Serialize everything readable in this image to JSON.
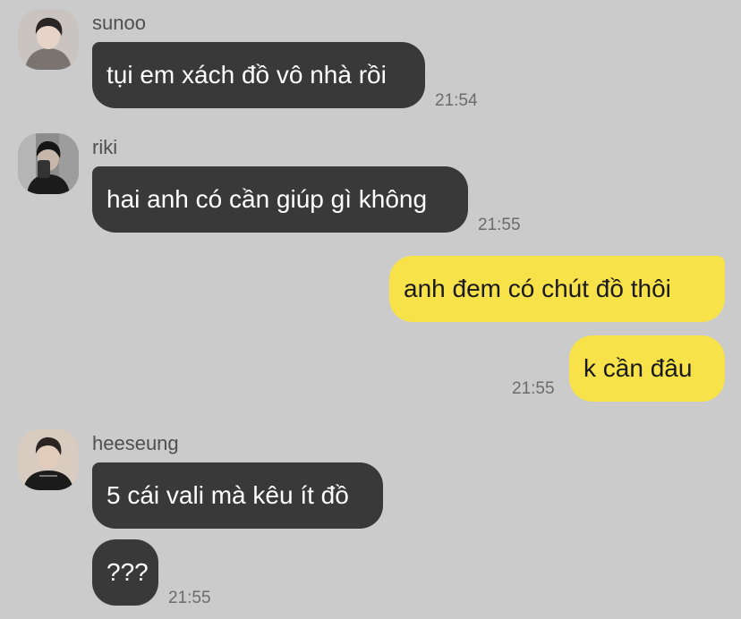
{
  "messages": [
    {
      "sender": "sunoo",
      "text": "tụi em xách đồ vô nhà rồi",
      "time": "21:54"
    },
    {
      "sender": "riki",
      "text": "hai anh có cần giúp gì không",
      "time": "21:55"
    },
    {
      "text": "anh đem có chút đồ thôi"
    },
    {
      "text": "k cần đâu",
      "time": "21:55"
    },
    {
      "sender": "heeseung",
      "text": "5 cái vali mà kêu ít đồ"
    },
    {
      "text": "???",
      "time": "21:55"
    }
  ],
  "colors": {
    "background": "#cbcbcb",
    "incoming_bubble": "#393939",
    "outgoing_bubble": "#f8e24a"
  }
}
